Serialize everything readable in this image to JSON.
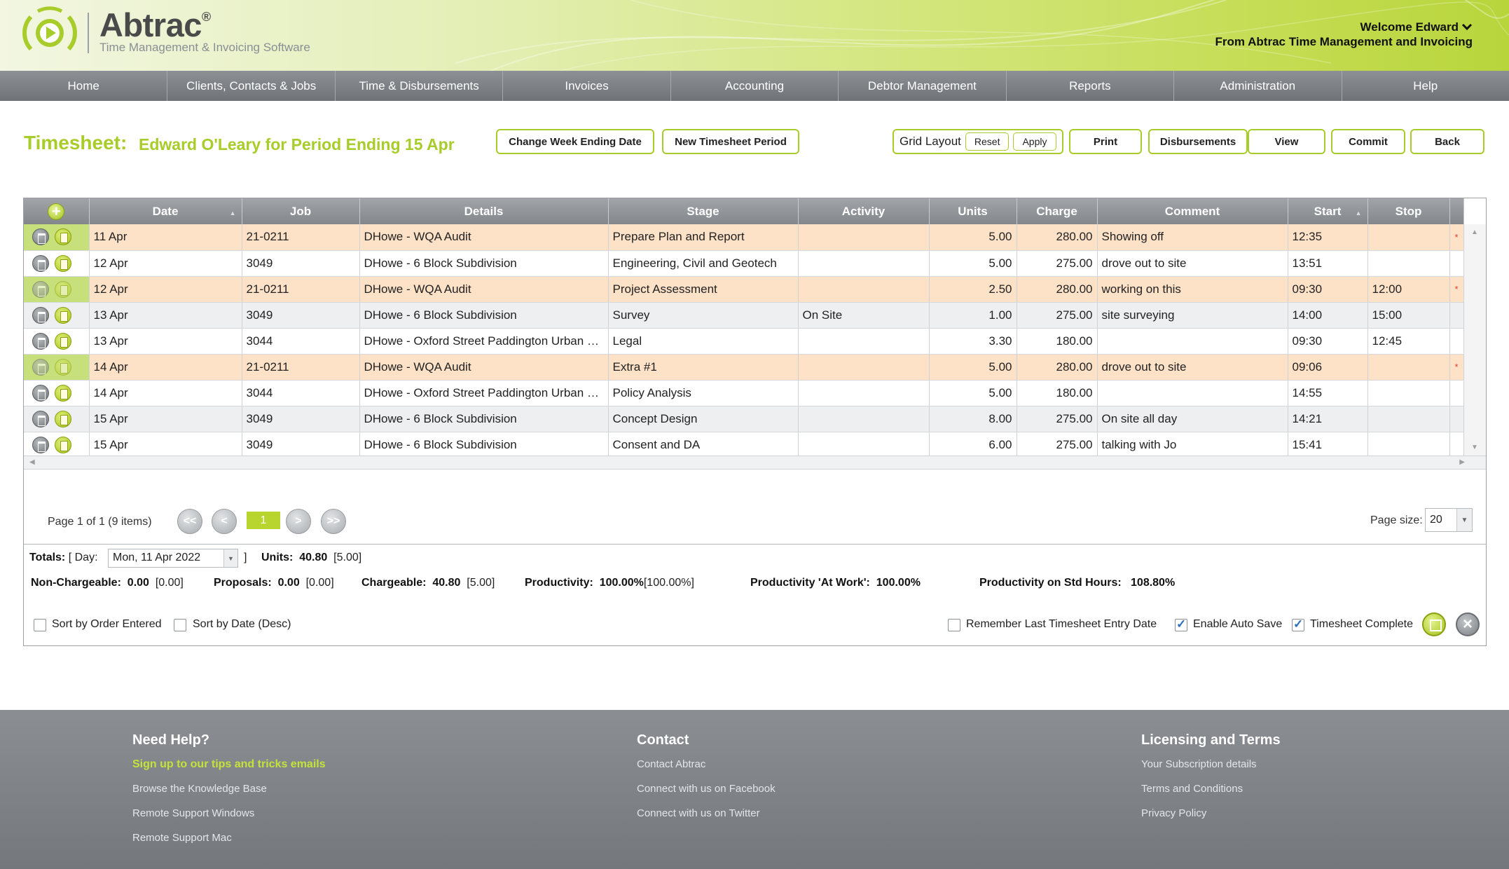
{
  "header": {
    "brand": "Abtrac",
    "registered": "®",
    "tagline": "Time Management & Invoicing Software",
    "welcome": "Welcome Edward",
    "from": "From Abtrac Time Management and Invoicing"
  },
  "nav": [
    "Home",
    "Clients, Contacts & Jobs",
    "Time & Disbursements",
    "Invoices",
    "Accounting",
    "Debtor Management",
    "Reports",
    "Administration",
    "Help"
  ],
  "title": {
    "label": "Timesheet:",
    "subtitle": "Edward O'Leary for Period Ending 15 Apr"
  },
  "toolbar": {
    "change_week": "Change Week Ending Date",
    "new_period": "New Timesheet Period",
    "grid_layout": "Grid Layout",
    "reset": "Reset",
    "apply": "Apply",
    "print": "Print",
    "disbursements": "Disbursements",
    "view": "View",
    "commit": "Commit",
    "back": "Back"
  },
  "grid": {
    "add_icon": "+",
    "columns": [
      "Date",
      "Job",
      "Details",
      "Stage",
      "Activity",
      "Units",
      "Charge",
      "Comment",
      "Start",
      "Stop"
    ],
    "rows": [
      {
        "date": "11 Apr",
        "job": "21-0211",
        "details": "DHowe - WQA Audit",
        "stage": "Prepare Plan and Report",
        "activity": "",
        "units": "5.00",
        "charge": "280.00",
        "comment": "Showing off",
        "start": "12:35",
        "stop": "",
        "flag": "*",
        "style": "hl"
      },
      {
        "date": "12 Apr",
        "job": "3049",
        "details": "DHowe - 6 Block Subdivision",
        "stage": "Engineering, Civil and Geotech",
        "activity": "",
        "units": "5.00",
        "charge": "275.00",
        "comment": "drove out to site",
        "start": "13:51",
        "stop": "",
        "flag": "",
        "style": "odd"
      },
      {
        "date": "12 Apr",
        "job": "21-0211",
        "details": "DHowe - WQA Audit",
        "stage": "Project Assessment",
        "activity": "",
        "units": "2.50",
        "charge": "280.00",
        "comment": "working on this",
        "start": "09:30",
        "stop": "12:00",
        "flag": "*",
        "style": "hl2"
      },
      {
        "date": "13 Apr",
        "job": "3049",
        "details": "DHowe - 6 Block Subdivision",
        "stage": "Survey",
        "activity": "On Site",
        "units": "1.00",
        "charge": "275.00",
        "comment": "site surveying",
        "start": "14:00",
        "stop": "15:00",
        "flag": "",
        "style": "even"
      },
      {
        "date": "13 Apr",
        "job": "3044",
        "details": "DHowe - Oxford Street Paddington Urban Design",
        "stage": "Legal",
        "activity": "",
        "units": "3.30",
        "charge": "180.00",
        "comment": "",
        "start": "09:30",
        "stop": "12:45",
        "flag": "",
        "style": "odd"
      },
      {
        "date": "14 Apr",
        "job": "21-0211",
        "details": "DHowe - WQA Audit",
        "stage": "Extra #1",
        "activity": "",
        "units": "5.00",
        "charge": "280.00",
        "comment": "drove out to site",
        "start": "09:06",
        "stop": "",
        "flag": "*",
        "style": "hl2"
      },
      {
        "date": "14 Apr",
        "job": "3044",
        "details": "DHowe - Oxford Street Paddington Urban Design",
        "stage": "Policy Analysis",
        "activity": "",
        "units": "5.00",
        "charge": "180.00",
        "comment": "",
        "start": "14:55",
        "stop": "",
        "flag": "",
        "style": "odd"
      },
      {
        "date": "15 Apr",
        "job": "3049",
        "details": "DHowe - 6 Block Subdivision",
        "stage": "Concept Design",
        "activity": "",
        "units": "8.00",
        "charge": "275.00",
        "comment": "On site all day",
        "start": "14:21",
        "stop": "",
        "flag": "",
        "style": "even"
      },
      {
        "date": "15 Apr",
        "job": "3049",
        "details": "DHowe - 6 Block Subdivision",
        "stage": "Consent and DA",
        "activity": "",
        "units": "6.00",
        "charge": "275.00",
        "comment": "talking with Jo",
        "start": "15:41",
        "stop": "",
        "flag": "",
        "style": "odd"
      }
    ]
  },
  "pager": {
    "info": "Page 1 of 1 (9 items)",
    "first": "<<",
    "prev": "<",
    "current": "1",
    "next": ">",
    "last": ">>",
    "page_size_label": "Page size:",
    "page_size": "20"
  },
  "totals": {
    "label": "Totals:",
    "day_open": "[ Day:",
    "day_value": "Mon, 11 Apr 2022",
    "day_close": "]",
    "units_label": "Units:",
    "units_value": "40.80",
    "units_bracket": "[5.00]",
    "non_chargeable_label": "Non-Chargeable:",
    "non_chargeable_value": "0.00",
    "non_chargeable_bracket": "[0.00]",
    "proposals_label": "Proposals:",
    "proposals_value": "0.00",
    "proposals_bracket": "[0.00]",
    "chargeable_label": "Chargeable:",
    "chargeable_value": "40.80",
    "chargeable_bracket": "[5.00]",
    "productivity_label": "Productivity:",
    "productivity_value": "100.00%",
    "productivity_bracket": "[100.00%]",
    "at_work_label": "Productivity 'At Work':",
    "at_work_value": "100.00%",
    "std_hours_label": "Productivity on Std Hours:",
    "std_hours_value": "108.80%"
  },
  "options": {
    "sort_order": "Sort by Order Entered",
    "sort_date": "Sort by Date (Desc)",
    "remember": "Remember Last Timesheet Entry Date",
    "auto_save": "Enable Auto Save",
    "complete": "Timesheet Complete"
  },
  "footer": {
    "help": {
      "title": "Need Help?",
      "links": [
        "Sign up to our tips and tricks emails",
        "Browse the Knowledge Base",
        "Remote Support Windows",
        "Remote Support Mac"
      ]
    },
    "contact": {
      "title": "Contact",
      "links": [
        "Contact Abtrac",
        "Connect with us on Facebook",
        "Connect with us on Twitter"
      ]
    },
    "licensing": {
      "title": "Licensing and Terms",
      "links": [
        "Your Subscription details",
        "Terms and Conditions",
        "Privacy Policy"
      ]
    }
  },
  "colors": {
    "accent": "#a8cc2a",
    "highlight_row": "#fde2c8",
    "nav": "#7f8388"
  }
}
